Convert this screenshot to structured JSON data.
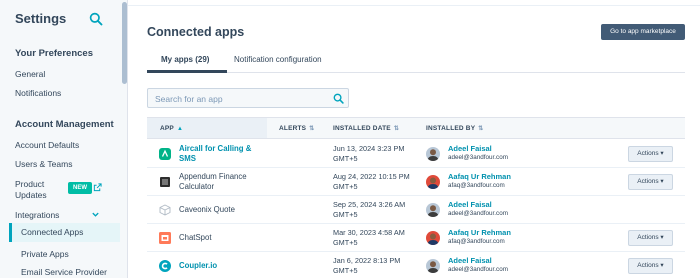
{
  "sidebar": {
    "title": "Settings",
    "sections": [
      {
        "heading": "Your Preferences"
      },
      {
        "heading": "Account Management"
      }
    ],
    "items": [
      {
        "label": "General"
      },
      {
        "label": "Notifications"
      },
      {
        "label": "Account Defaults"
      },
      {
        "label": "Users & Teams"
      },
      {
        "label": "Product Updates",
        "badge": "NEW"
      },
      {
        "label": "Integrations"
      },
      {
        "label": "Connected Apps"
      },
      {
        "label": "Private Apps"
      },
      {
        "label": "Email Service Provider"
      }
    ]
  },
  "main": {
    "title": "Connected apps",
    "marketplace_button": "Go to app marketplace",
    "tabs": [
      {
        "label": "My apps (29)"
      },
      {
        "label": "Notification configuration"
      }
    ],
    "search": {
      "placeholder": "Search for an app"
    },
    "table": {
      "headers": [
        "APP",
        "ALERTS",
        "INSTALLED DATE",
        "INSTALLED BY"
      ],
      "rows": [
        {
          "app": "Aircall for Calling & SMS",
          "date": "Jun 13, 2024 3:23 PM GMT+5",
          "user": "Adeel Faisal",
          "email": "adeel@3andfour.com",
          "action": "Actions",
          "icon": "aircall-icon",
          "link": true
        },
        {
          "app": "Appendum Finance Calculator",
          "date": "Aug 24, 2022 10:15 PM GMT+5",
          "user": "Aafaq Ur Rehman",
          "email": "afaq@3andfour.com",
          "action": "Actions",
          "icon": "appendum-icon",
          "link": false
        },
        {
          "app": "Caveonix Quote",
          "date": "Sep 25, 2024 3:26 AM GMT+5",
          "user": "Adeel Faisal",
          "email": "adeel@3andfour.com",
          "action": "",
          "icon": "cube-icon",
          "link": false
        },
        {
          "app": "ChatSpot",
          "date": "Mar 30, 2023 4:58 AM GMT+5",
          "user": "Aafaq Ur Rehman",
          "email": "afaq@3andfour.com",
          "action": "Actions",
          "icon": "chatspot-icon",
          "link": false
        },
        {
          "app": "Coupler.io",
          "date": "Jan 6, 2022 8:13 PM GMT+5",
          "user": "Adeel Faisal",
          "email": "adeel@3andfour.com",
          "action": "Actions",
          "icon": "coupler-icon",
          "link": true
        }
      ]
    }
  },
  "colors": {
    "accent": "#00a4bd",
    "link": "#0091ae",
    "text": "#33475b",
    "button_dark": "#425b76",
    "badge": "#00bda5"
  }
}
